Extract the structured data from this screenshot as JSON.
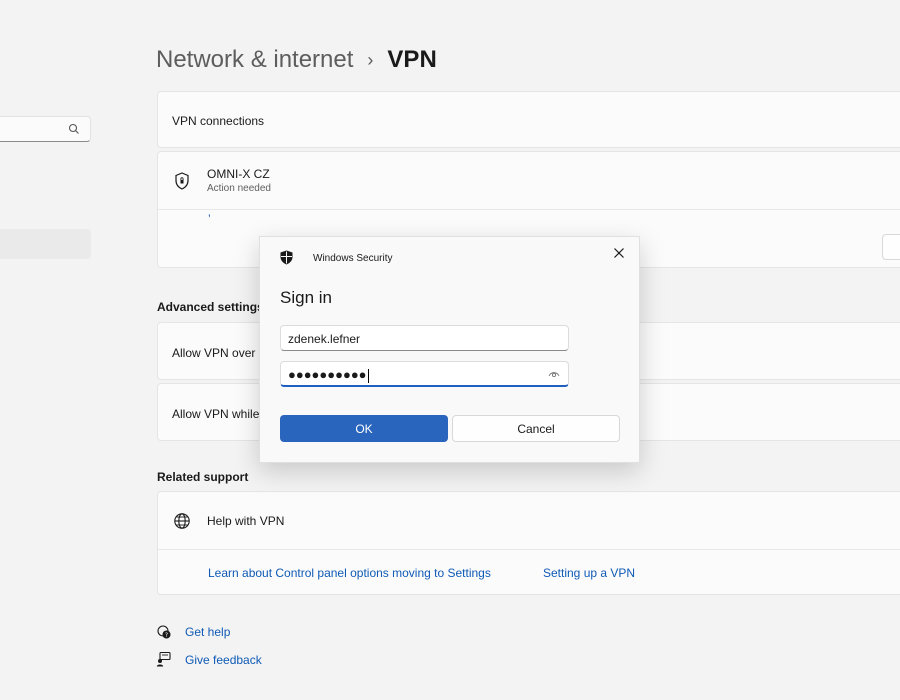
{
  "breadcrumb": {
    "parent": "Network & internet",
    "separator": "›",
    "current": "VPN"
  },
  "vpn_connections": {
    "title": "VPN connections"
  },
  "connection": {
    "name": "OMNI-X CZ",
    "status": "Action needed",
    "mark": "’"
  },
  "advanced": {
    "title": "Advanced settings",
    "item1": "Allow VPN over r",
    "item2": "Allow VPN while"
  },
  "related": {
    "title": "Related support",
    "help": "Help with VPN",
    "link1": "Learn about Control panel options moving to Settings",
    "link2": "Setting up a VPN"
  },
  "footer": {
    "get_help": "Get help",
    "give_feedback": "Give feedback"
  },
  "dialog": {
    "app": "Windows Security",
    "heading": "Sign in",
    "username": "zdenek.lefner",
    "password_mask": "●●●●●●●●●●",
    "ok": "OK",
    "cancel": "Cancel"
  },
  "colors": {
    "accent": "#2a65bd",
    "link": "#0f5ab5",
    "background": "#f3f3f3"
  },
  "icons": [
    "search-icon",
    "shield-icon",
    "windows-security-icon",
    "close-icon",
    "eye-icon",
    "globe-icon",
    "get-help-icon",
    "feedback-icon"
  ]
}
